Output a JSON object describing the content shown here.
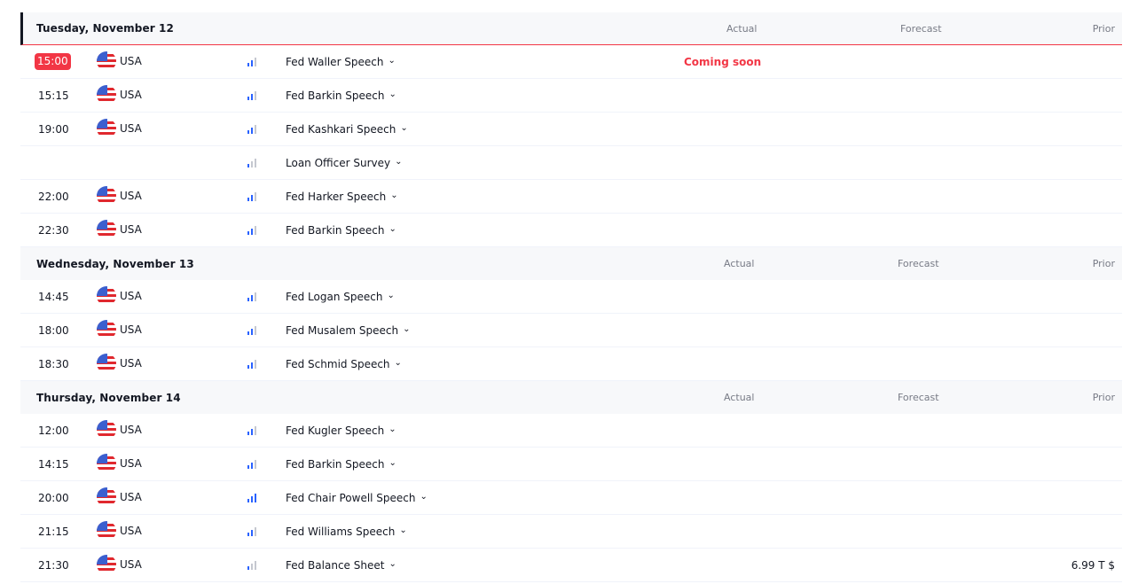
{
  "columns": {
    "actual": "Actual",
    "forecast": "Forecast",
    "prior": "Prior"
  },
  "days": [
    {
      "title": "Tuesday, November 12",
      "events": [
        {
          "time": "15:00",
          "country": "USA",
          "importance": 2,
          "name": "Fed Waller Speech",
          "actual": "Coming soon",
          "prior": "",
          "live": true
        },
        {
          "time": "15:15",
          "country": "USA",
          "importance": 2,
          "name": "Fed Barkin Speech",
          "actual": "",
          "prior": ""
        },
        {
          "time": "19:00",
          "country": "USA",
          "importance": 2,
          "name": "Fed Kashkari Speech",
          "actual": "",
          "prior": ""
        },
        {
          "time": "",
          "country": "",
          "importance": 1,
          "name": "Loan Officer Survey",
          "actual": "",
          "prior": ""
        },
        {
          "time": "22:00",
          "country": "USA",
          "importance": 2,
          "name": "Fed Harker Speech",
          "actual": "",
          "prior": ""
        },
        {
          "time": "22:30",
          "country": "USA",
          "importance": 2,
          "name": "Fed Barkin Speech",
          "actual": "",
          "prior": ""
        }
      ]
    },
    {
      "title": "Wednesday, November 13",
      "events": [
        {
          "time": "14:45",
          "country": "USA",
          "importance": 2,
          "name": "Fed Logan Speech",
          "actual": "",
          "prior": ""
        },
        {
          "time": "18:00",
          "country": "USA",
          "importance": 2,
          "name": "Fed Musalem Speech",
          "actual": "",
          "prior": ""
        },
        {
          "time": "18:30",
          "country": "USA",
          "importance": 2,
          "name": "Fed Schmid Speech",
          "actual": "",
          "prior": ""
        }
      ]
    },
    {
      "title": "Thursday, November 14",
      "events": [
        {
          "time": "12:00",
          "country": "USA",
          "importance": 2,
          "name": "Fed Kugler Speech",
          "actual": "",
          "prior": ""
        },
        {
          "time": "14:15",
          "country": "USA",
          "importance": 2,
          "name": "Fed Barkin Speech",
          "actual": "",
          "prior": ""
        },
        {
          "time": "20:00",
          "country": "USA",
          "importance": 3,
          "name": "Fed Chair Powell Speech",
          "actual": "",
          "prior": ""
        },
        {
          "time": "21:15",
          "country": "USA",
          "importance": 2,
          "name": "Fed Williams Speech",
          "actual": "",
          "prior": ""
        },
        {
          "time": "21:30",
          "country": "USA",
          "importance": 1,
          "name": "Fed Balance Sheet",
          "actual": "",
          "prior": "6.99 T $"
        }
      ]
    }
  ],
  "icons": {
    "expand": "chevron-down-icon",
    "flag": "us-flag-icon",
    "importance": "importance-bars-icon"
  },
  "colors": {
    "accent": "#f23645",
    "importance_on": "#2962ff",
    "importance_off": "#c5c8d0",
    "header_bg": "#f7f8fa"
  }
}
